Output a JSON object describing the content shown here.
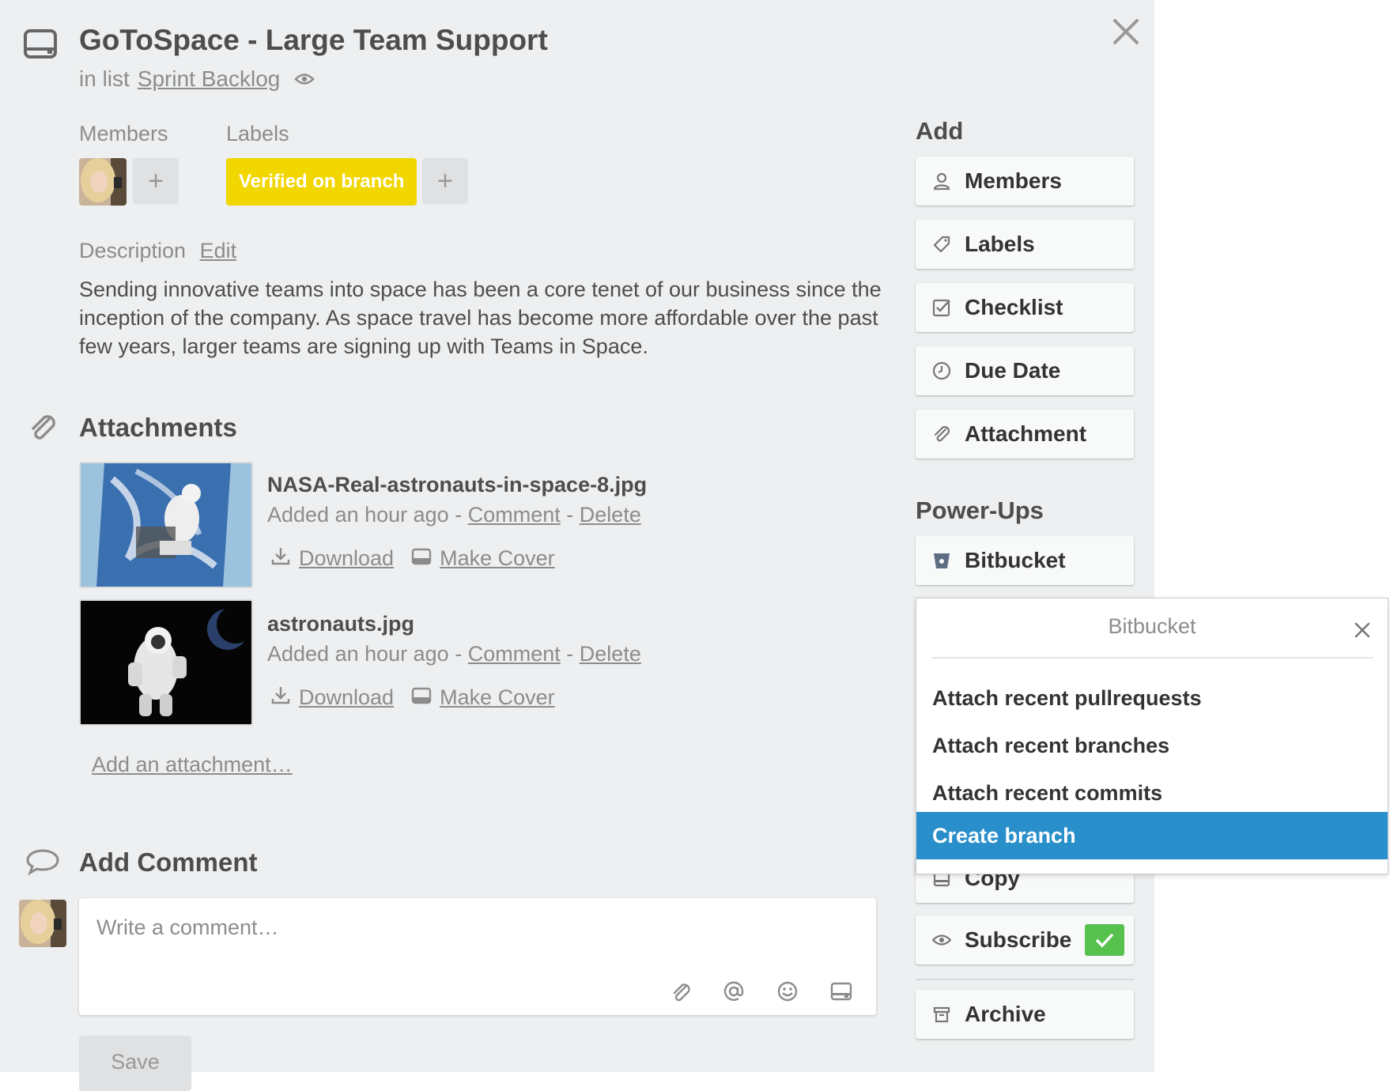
{
  "card": {
    "title": "GoToSpace - Large Team Support",
    "in_list_prefix": "in list",
    "list_name": "Sprint Backlog"
  },
  "members": {
    "heading": "Members",
    "add": "+"
  },
  "labels": {
    "heading": "Labels",
    "items": [
      {
        "text": "Verified on branch",
        "color": "#f2d600"
      }
    ],
    "add": "+"
  },
  "description": {
    "heading": "Description",
    "edit": "Edit",
    "text": "Sending innovative teams into space has been a core tenet of our business since the inception of the company. As space travel has become more affordable over the past few years, larger teams are signing up with Teams in Space."
  },
  "attachments": {
    "heading": "Attachments",
    "items": [
      {
        "name": "NASA-Real-astronauts-in-space-8.jpg",
        "added": "Added an hour ago",
        "sep": "-",
        "comment": "Comment",
        "delete": "Delete",
        "download": "Download",
        "make_cover": "Make Cover"
      },
      {
        "name": "astronauts.jpg",
        "added": "Added an hour ago",
        "sep": "-",
        "comment": "Comment",
        "delete": "Delete",
        "download": "Download",
        "make_cover": "Make Cover"
      }
    ],
    "add_link": "Add an attachment…"
  },
  "comment": {
    "heading": "Add Comment",
    "placeholder": "Write a comment…",
    "save": "Save"
  },
  "sidebar": {
    "add_heading": "Add",
    "add_buttons": [
      "Members",
      "Labels",
      "Checklist",
      "Due Date",
      "Attachment"
    ],
    "powerups_heading": "Power-Ups",
    "powerups": [
      "Bitbucket"
    ],
    "actions": {
      "copy": "Copy",
      "subscribe": "Subscribe",
      "archive": "Archive"
    }
  },
  "popover": {
    "title": "Bitbucket",
    "items": [
      "Attach recent pullrequests",
      "Attach recent branches",
      "Attach recent commits",
      "Create branch"
    ],
    "active_index": 3
  },
  "colors": {
    "card_bg": "#edeff0",
    "label_yellow": "#f2d600",
    "accent_blue": "#298fca",
    "check_green": "#57c14e"
  }
}
